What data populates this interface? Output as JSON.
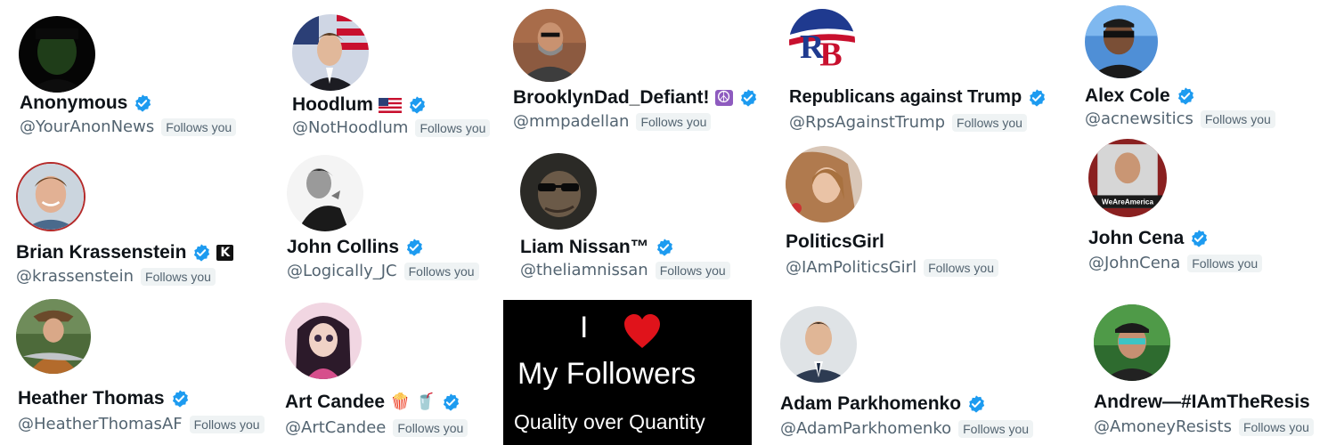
{
  "follows_label": "Follows you",
  "colors": {
    "verified_blue": "#1d9bf0",
    "name_text": "#0f1419",
    "handle_text": "#536471",
    "badge_bg": "#eff3f4",
    "promo_bg": "#000000",
    "heart_red": "#e0131b"
  },
  "accounts": [
    {
      "name": "Anonymous",
      "handle": "@YourAnonNews",
      "verified": true
    },
    {
      "name": "Hoodlum",
      "handle": "@NotHoodlum",
      "verified": true,
      "extra": "us-flag"
    },
    {
      "name": "BrooklynDad_Defiant!",
      "handle": "@mmpadellan",
      "verified": true,
      "extra": "☮"
    },
    {
      "name": "Republicans against Trump",
      "handle": "@RpsAgainstTrump",
      "verified": true
    },
    {
      "name": "Alex Cole",
      "handle": "@acnewsitics",
      "verified": true
    },
    {
      "name": "Brian Krassenstein",
      "handle": "@krassenstein",
      "verified": true,
      "extra": "K"
    },
    {
      "name": "John Collins",
      "handle": "@Logically_JC",
      "verified": true
    },
    {
      "name": "Liam Nissan™",
      "handle": "@theliamnissan",
      "verified": true
    },
    {
      "name": "PoliticsGirl",
      "handle": "@IAmPoliticsGirl",
      "verified": false
    },
    {
      "name": "John Cena",
      "handle": "@JohnCena",
      "verified": true,
      "avatar_text": "WeAreAmerica"
    },
    {
      "name": "Heather Thomas",
      "handle": "@HeatherThomasAF",
      "verified": true
    },
    {
      "name": "Art Candee",
      "handle": "@ArtCandee",
      "verified": true,
      "extra": "🍿 🥤"
    },
    {
      "name": "Adam Parkhomenko",
      "handle": "@AdamParkhomenko",
      "verified": true
    },
    {
      "name": "Andrew—#IAmTheResis",
      "handle": "@AmoneyResists",
      "verified": false
    }
  ],
  "promo": {
    "line1_text": "I",
    "heart_icon": "heart-icon",
    "line2": "My Followers",
    "line3": "Quality over Quantity"
  },
  "avatar_logo_text": "RB"
}
